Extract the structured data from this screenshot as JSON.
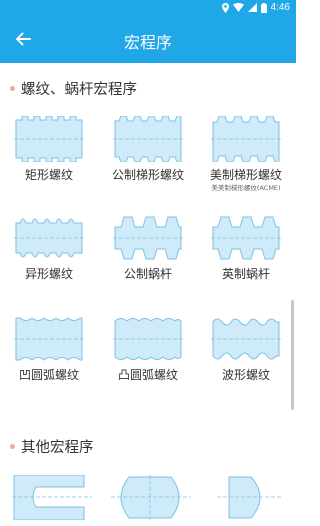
{
  "status_bar": {
    "time": "4:46"
  },
  "app_bar": {
    "title": "宏程序"
  },
  "sections": [
    {
      "title": "螺纹、蜗杆宏程序",
      "items": [
        {
          "label": "矩形螺纹"
        },
        {
          "label": "公制梯形螺纹"
        },
        {
          "label": "美制梯形螺纹",
          "sublabel": "美美制梯形螺纹(ACME)"
        },
        {
          "label": "异形螺纹"
        },
        {
          "label": "公制蜗杆"
        },
        {
          "label": "英制蜗杆"
        },
        {
          "label": "凹圆弧螺纹"
        },
        {
          "label": "凸圆弧螺纹"
        },
        {
          "label": "波形螺纹"
        }
      ]
    },
    {
      "title": "其他宏程序"
    }
  ],
  "colors": {
    "primary": "#1fa7e8",
    "illustration_fill": "#cfeaf8",
    "illustration_stroke": "#7cc2e6",
    "section_dot": "#f3a7a0"
  }
}
